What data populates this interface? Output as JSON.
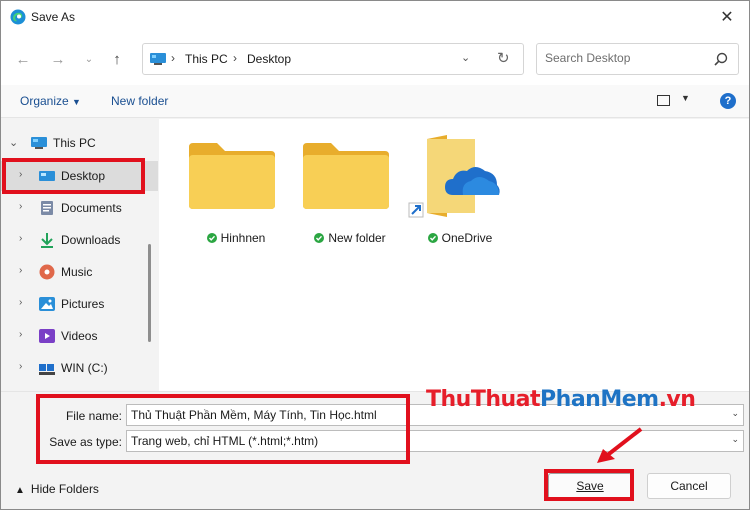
{
  "window": {
    "title": "Save As"
  },
  "address": {
    "segments": [
      "This PC",
      "Desktop"
    ]
  },
  "search": {
    "placeholder": "Search Desktop"
  },
  "toolbar": {
    "organize": "Organize",
    "new_folder": "New folder",
    "help": "?"
  },
  "nav_pane": {
    "root": "This PC",
    "items": [
      {
        "label": "Desktop",
        "icon": "desktop-icon",
        "selected": true
      },
      {
        "label": "Documents",
        "icon": "documents-icon"
      },
      {
        "label": "Downloads",
        "icon": "downloads-icon"
      },
      {
        "label": "Music",
        "icon": "music-icon"
      },
      {
        "label": "Pictures",
        "icon": "pictures-icon"
      },
      {
        "label": "Videos",
        "icon": "videos-icon"
      },
      {
        "label": "WIN (C:)",
        "icon": "drive-icon"
      }
    ]
  },
  "files": [
    {
      "name": "Hinhnen",
      "type": "folder",
      "status": "synced"
    },
    {
      "name": "New folder",
      "type": "folder",
      "status": "synced"
    },
    {
      "name": "OneDrive",
      "type": "onedrive-shortcut",
      "status": "synced"
    }
  ],
  "form": {
    "file_name_label": "File name:",
    "file_name_value": "Thủ Thuật Phần Mềm, Máy Tính, Tin Học.html",
    "save_type_label": "Save as type:",
    "save_type_value": "Trang web, chỉ HTML (*.html;*.htm)"
  },
  "footer": {
    "hide_folders": "Hide Folders",
    "save": "Save",
    "cancel": "Cancel"
  },
  "watermark": {
    "part1": "ThuThuat",
    "part2": "PhanMem",
    "part3": ".vn"
  },
  "colors": {
    "annotation": "#e1101d",
    "folder": "#f6c94c",
    "accent": "#1f6fcb",
    "sync": "#2ba642"
  }
}
